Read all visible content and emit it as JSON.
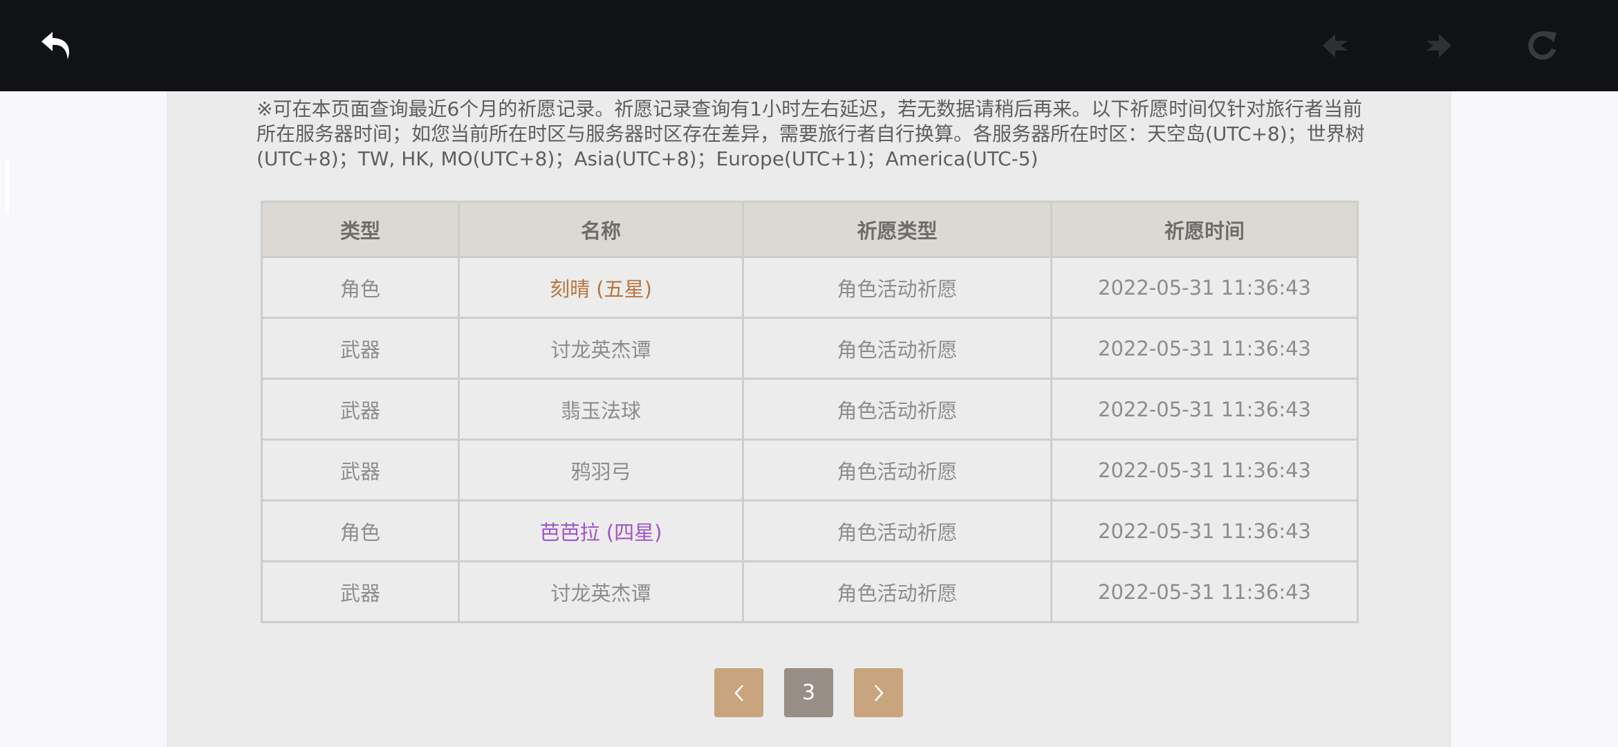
{
  "notice": "※可在本页面查询最近6个月的祈愿记录。祈愿记录查询有1小时左右延迟，若无数据请稍后再来。以下祈愿时间仅针对旅行者当前所在服务器时间；如您当前所在时区与服务器时区存在差异，需要旅行者自行换算。各服务器所在时区：天空岛(UTC+8)；世界树(UTC+8)；TW, HK, MO(UTC+8)；Asia(UTC+8)；Europe(UTC+1)；America(UTC-5)",
  "table": {
    "headers": [
      "类型",
      "名称",
      "祈愿类型",
      "祈愿时间"
    ],
    "rows": [
      {
        "type": "角色",
        "name": "刻晴 (五星)",
        "wish_type": "角色活动祈愿",
        "time": "2022-05-31 11:36:43",
        "name_color": "#b8753e"
      },
      {
        "type": "武器",
        "name": "讨龙英杰谭",
        "wish_type": "角色活动祈愿",
        "time": "2022-05-31 11:36:43",
        "name_color": "#8d8d8d"
      },
      {
        "type": "武器",
        "name": "翡玉法球",
        "wish_type": "角色活动祈愿",
        "time": "2022-05-31 11:36:43",
        "name_color": "#8d8d8d"
      },
      {
        "type": "武器",
        "name": "鸦羽弓",
        "wish_type": "角色活动祈愿",
        "time": "2022-05-31 11:36:43",
        "name_color": "#8d8d8d"
      },
      {
        "type": "角色",
        "name": "芭芭拉 (四星)",
        "wish_type": "角色活动祈愿",
        "time": "2022-05-31 11:36:43",
        "name_color": "#a155c8"
      },
      {
        "type": "武器",
        "name": "讨龙英杰谭",
        "wish_type": "角色活动祈愿",
        "time": "2022-05-31 11:36:43",
        "name_color": "#8d8d8d"
      }
    ]
  },
  "pagination": {
    "prev_icon": "chevron-left-icon",
    "current_page": "3",
    "next_icon": "chevron-right-icon"
  },
  "toolbar": {
    "back_icon": "back-arrow-icon",
    "nav_back_icon": "nav-back-icon",
    "nav_forward_icon": "nav-forward-icon",
    "reload_icon": "reload-icon"
  },
  "colors": {
    "topbar": "#111216",
    "panel": "#ebebeb",
    "header_bg": "#dcd9d5",
    "five_star": "#b8753e",
    "four_star": "#a155c8",
    "pager_arrow": "#c9a57f",
    "pager_current": "#978e86"
  }
}
